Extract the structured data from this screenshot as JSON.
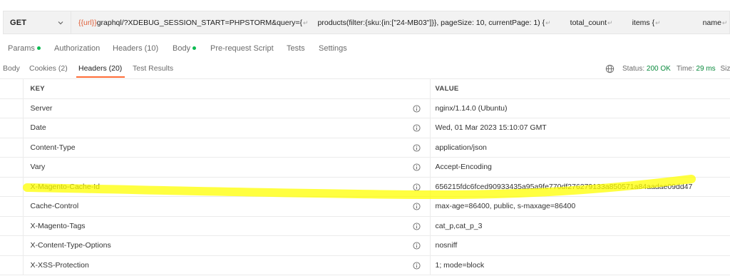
{
  "request": {
    "method": "GET",
    "url_parts": {
      "var": "{{url}}",
      "path": "graphql/?XDEBUG_SESSION_START=PHPSTORM&query={",
      "seg2": "products(filter:{sku:{in:[\"24-MB03\"]}}, pageSize: 10, currentPage: 1) {",
      "seg3": "total_count",
      "seg4": "items {",
      "seg5": "name"
    }
  },
  "request_tabs": {
    "params": "Params",
    "authorization": "Authorization",
    "headers": "Headers (10)",
    "body": "Body",
    "pre_request": "Pre-request Script",
    "tests": "Tests",
    "settings": "Settings"
  },
  "response_tabs": {
    "body": "Body",
    "cookies": "Cookies (2)",
    "headers": "Headers (20)",
    "test_results": "Test Results"
  },
  "status": {
    "status_label": "Status:",
    "status_value": "200 OK",
    "time_label": "Time:",
    "time_value": "29 ms",
    "size_label": "Siz"
  },
  "table": {
    "key_header": "KEY",
    "value_header": "VALUE",
    "rows": [
      {
        "key": "Server",
        "value": "nginx/1.14.0 (Ubuntu)"
      },
      {
        "key": "Date",
        "value": "Wed, 01 Mar 2023 15:10:07 GMT"
      },
      {
        "key": "Content-Type",
        "value": "application/json"
      },
      {
        "key": "Vary",
        "value": "Accept-Encoding"
      },
      {
        "key": "X-Magento-Cache-Id",
        "value": "656215fdc6fced90933435a95a9fe770df276279133a850571a84aadae09dd47"
      },
      {
        "key": "Cache-Control",
        "value": "max-age=86400, public, s-maxage=86400"
      },
      {
        "key": "X-Magento-Tags",
        "value": "cat_p,cat_p_3"
      },
      {
        "key": "X-Content-Type-Options",
        "value": "nosniff"
      },
      {
        "key": "X-XSS-Protection",
        "value": "1; mode=block"
      }
    ]
  },
  "icons": {
    "method_dropdown": "chevron-down-icon",
    "globe": "globe-icon",
    "info": "info-icon",
    "newline": "return-arrow-icon"
  },
  "colors": {
    "accent": "#ff6c37",
    "status_ok": "#0a8a3d",
    "dot": "#0cbb52",
    "variable": "#e0603a",
    "highlight": "#ffff00"
  }
}
